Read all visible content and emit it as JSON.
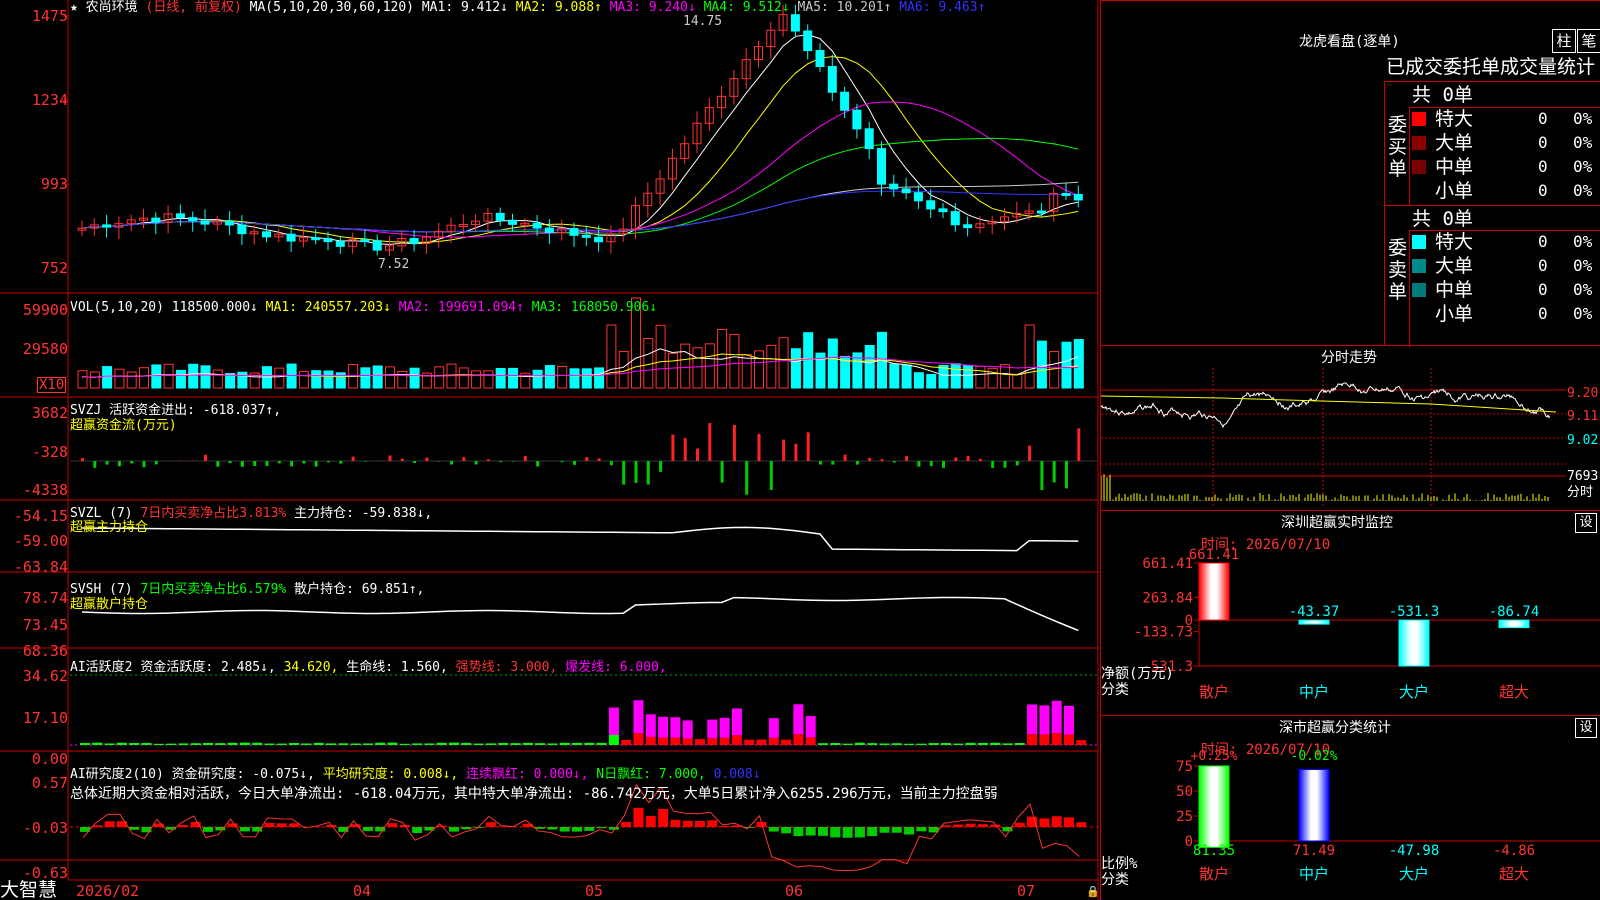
{
  "app": {
    "brand": "大智慧"
  },
  "k_header": {
    "star": "★",
    "name": "农尚环境",
    "period": "(日线, 前复权)",
    "ma_params": "MA(5,10,20,30,60,120)",
    "ma1": "MA1: 9.412↓",
    "ma2": "MA2: 9.088↑",
    "ma3": "MA3: 9.240↓",
    "ma4": "MA4: 9.512↓",
    "ma5": "MA5: 10.201↑",
    "ma6": "MA6: 9.463↑"
  },
  "k_axis": [
    "1475",
    "1234",
    "993",
    "752"
  ],
  "k_notes": {
    "high": "14.75",
    "low": "7.52"
  },
  "vol": {
    "header": "VOL(5,10,20)",
    "val": "118500.000↓",
    "ma1": "MA1: 240557.203↓",
    "ma2": "MA2: 199691.094↑",
    "ma3": "MA3: 168050.906↓",
    "axis": [
      "59900",
      "29580"
    ],
    "unit": "X10"
  },
  "svzj": {
    "h1": "SVZJ  活跃资金进出: -618.037↑,",
    "h2": "超赢资金流(万元)",
    "axis": [
      "3682",
      "-328",
      "-4338"
    ]
  },
  "svzl": {
    "h1a": "SVZL (7)",
    "h1b": "7日内买卖净占比3.813%",
    "h1c": "主力持仓: -59.838↓,",
    "h2": "超赢主力持仓",
    "axis": [
      "-54.15",
      "-59.00",
      "-63.84"
    ]
  },
  "svsh": {
    "h1a": "SVSH (7)",
    "h1b": "7日内买卖净占比6.579%",
    "h1c": "散户持仓: 69.851↑,",
    "h2": "超赢散户持仓",
    "axis": [
      "78.74",
      "73.45",
      "68.36"
    ]
  },
  "ai1": {
    "a": "AI活跃度2",
    "b": "资金活跃度: 2.485↓,",
    "c": "34.620,",
    "d": "生命线: 1.560,",
    "e": "强势线: 3.000,",
    "f": "爆发线: 6.000,",
    "axis": [
      "34.62",
      "17.10",
      "0.00"
    ]
  },
  "ai2": {
    "a": "AI研究度2(10)",
    "b": "资金研究度: -0.075↓,",
    "c": "平均研究度: 0.008↓,",
    "d": "连续飘红: 0.000↓,",
    "e": "N日飘红: 7.000,",
    "f": "0.008↓",
    "summary": "总体近期大资金相对活跃，今日大单净流出: -618.04万元，其中特大单净流出: -86.742万元，大单5日累计净入6255.296万元，当前主力控盘弱",
    "axis": [
      "0.57",
      "-0.03",
      "-0.63"
    ]
  },
  "dates": [
    "2026/02",
    "04",
    "05",
    "06",
    "07"
  ],
  "lhb": {
    "title": "龙虎看盘(逐单)",
    "btn1": "柱",
    "btn2": "笔",
    "sub": "已成交委托单成交量统计",
    "buy": {
      "side": "委买单",
      "count": "共 0单",
      "rows": [
        {
          "label": "特大",
          "v": "0",
          "p": "0%",
          "color": "#ff0000"
        },
        {
          "label": "大单",
          "v": "0",
          "p": "0%",
          "color": "#880000"
        },
        {
          "label": "中单",
          "v": "0",
          "p": "0%",
          "color": "#770000"
        },
        {
          "label": "小单",
          "v": "0",
          "p": "0%",
          "color": ""
        }
      ]
    },
    "sell": {
      "side": "委卖单",
      "count": "共 0单",
      "rows": [
        {
          "label": "特大",
          "v": "0",
          "p": "0%",
          "color": "#00ffff"
        },
        {
          "label": "大单",
          "v": "0",
          "p": "0%",
          "color": "#008a8a"
        },
        {
          "label": "中单",
          "v": "0",
          "p": "0%",
          "color": "#007a7a"
        },
        {
          "label": "小单",
          "v": "0",
          "p": "0%",
          "color": ""
        }
      ]
    }
  },
  "intraday": {
    "title": "分时走势",
    "prices": [
      "9.20",
      "9.11",
      "9.02"
    ],
    "vol": "7693",
    "unit": "分时"
  },
  "monitor": {
    "title": "深圳超赢实时监控",
    "set": "设",
    "time": "时间: 2026/07/10",
    "ylab1": "净额(万元)",
    "ylab2": "分类"
  },
  "classify": {
    "title": "深市超赢分类统计",
    "set": "设",
    "time": "时间: 2026/07/10",
    "ylab1": "比例%",
    "ylab2": "分类"
  },
  "chart_data": [
    {
      "type": "bar",
      "title": "深圳超赢实时监控",
      "ylabel": "净额(万元)",
      "xlabel": "分类",
      "categories": [
        "散户",
        "中户",
        "大户",
        "超大"
      ],
      "values": [
        661.41,
        -43.37,
        -531.3,
        -86.74
      ],
      "ylim": [
        -531.3,
        661.41
      ],
      "yticks": [
        "661.41",
        "263.84",
        "0",
        "-133.73",
        "-531.3"
      ]
    },
    {
      "type": "bar",
      "title": "深市超赢分类统计",
      "ylabel": "比例%",
      "xlabel": "分类",
      "categories": [
        "散户",
        "中户",
        "大户",
        "超大"
      ],
      "values": [
        81.35,
        71.49,
        -47.98,
        -4.86
      ],
      "change": [
        "+0.25%",
        "-0.02%",
        "",
        ""
      ],
      "ylim": [
        0,
        75
      ],
      "yticks": [
        "75",
        "50",
        "25",
        "0"
      ]
    }
  ]
}
